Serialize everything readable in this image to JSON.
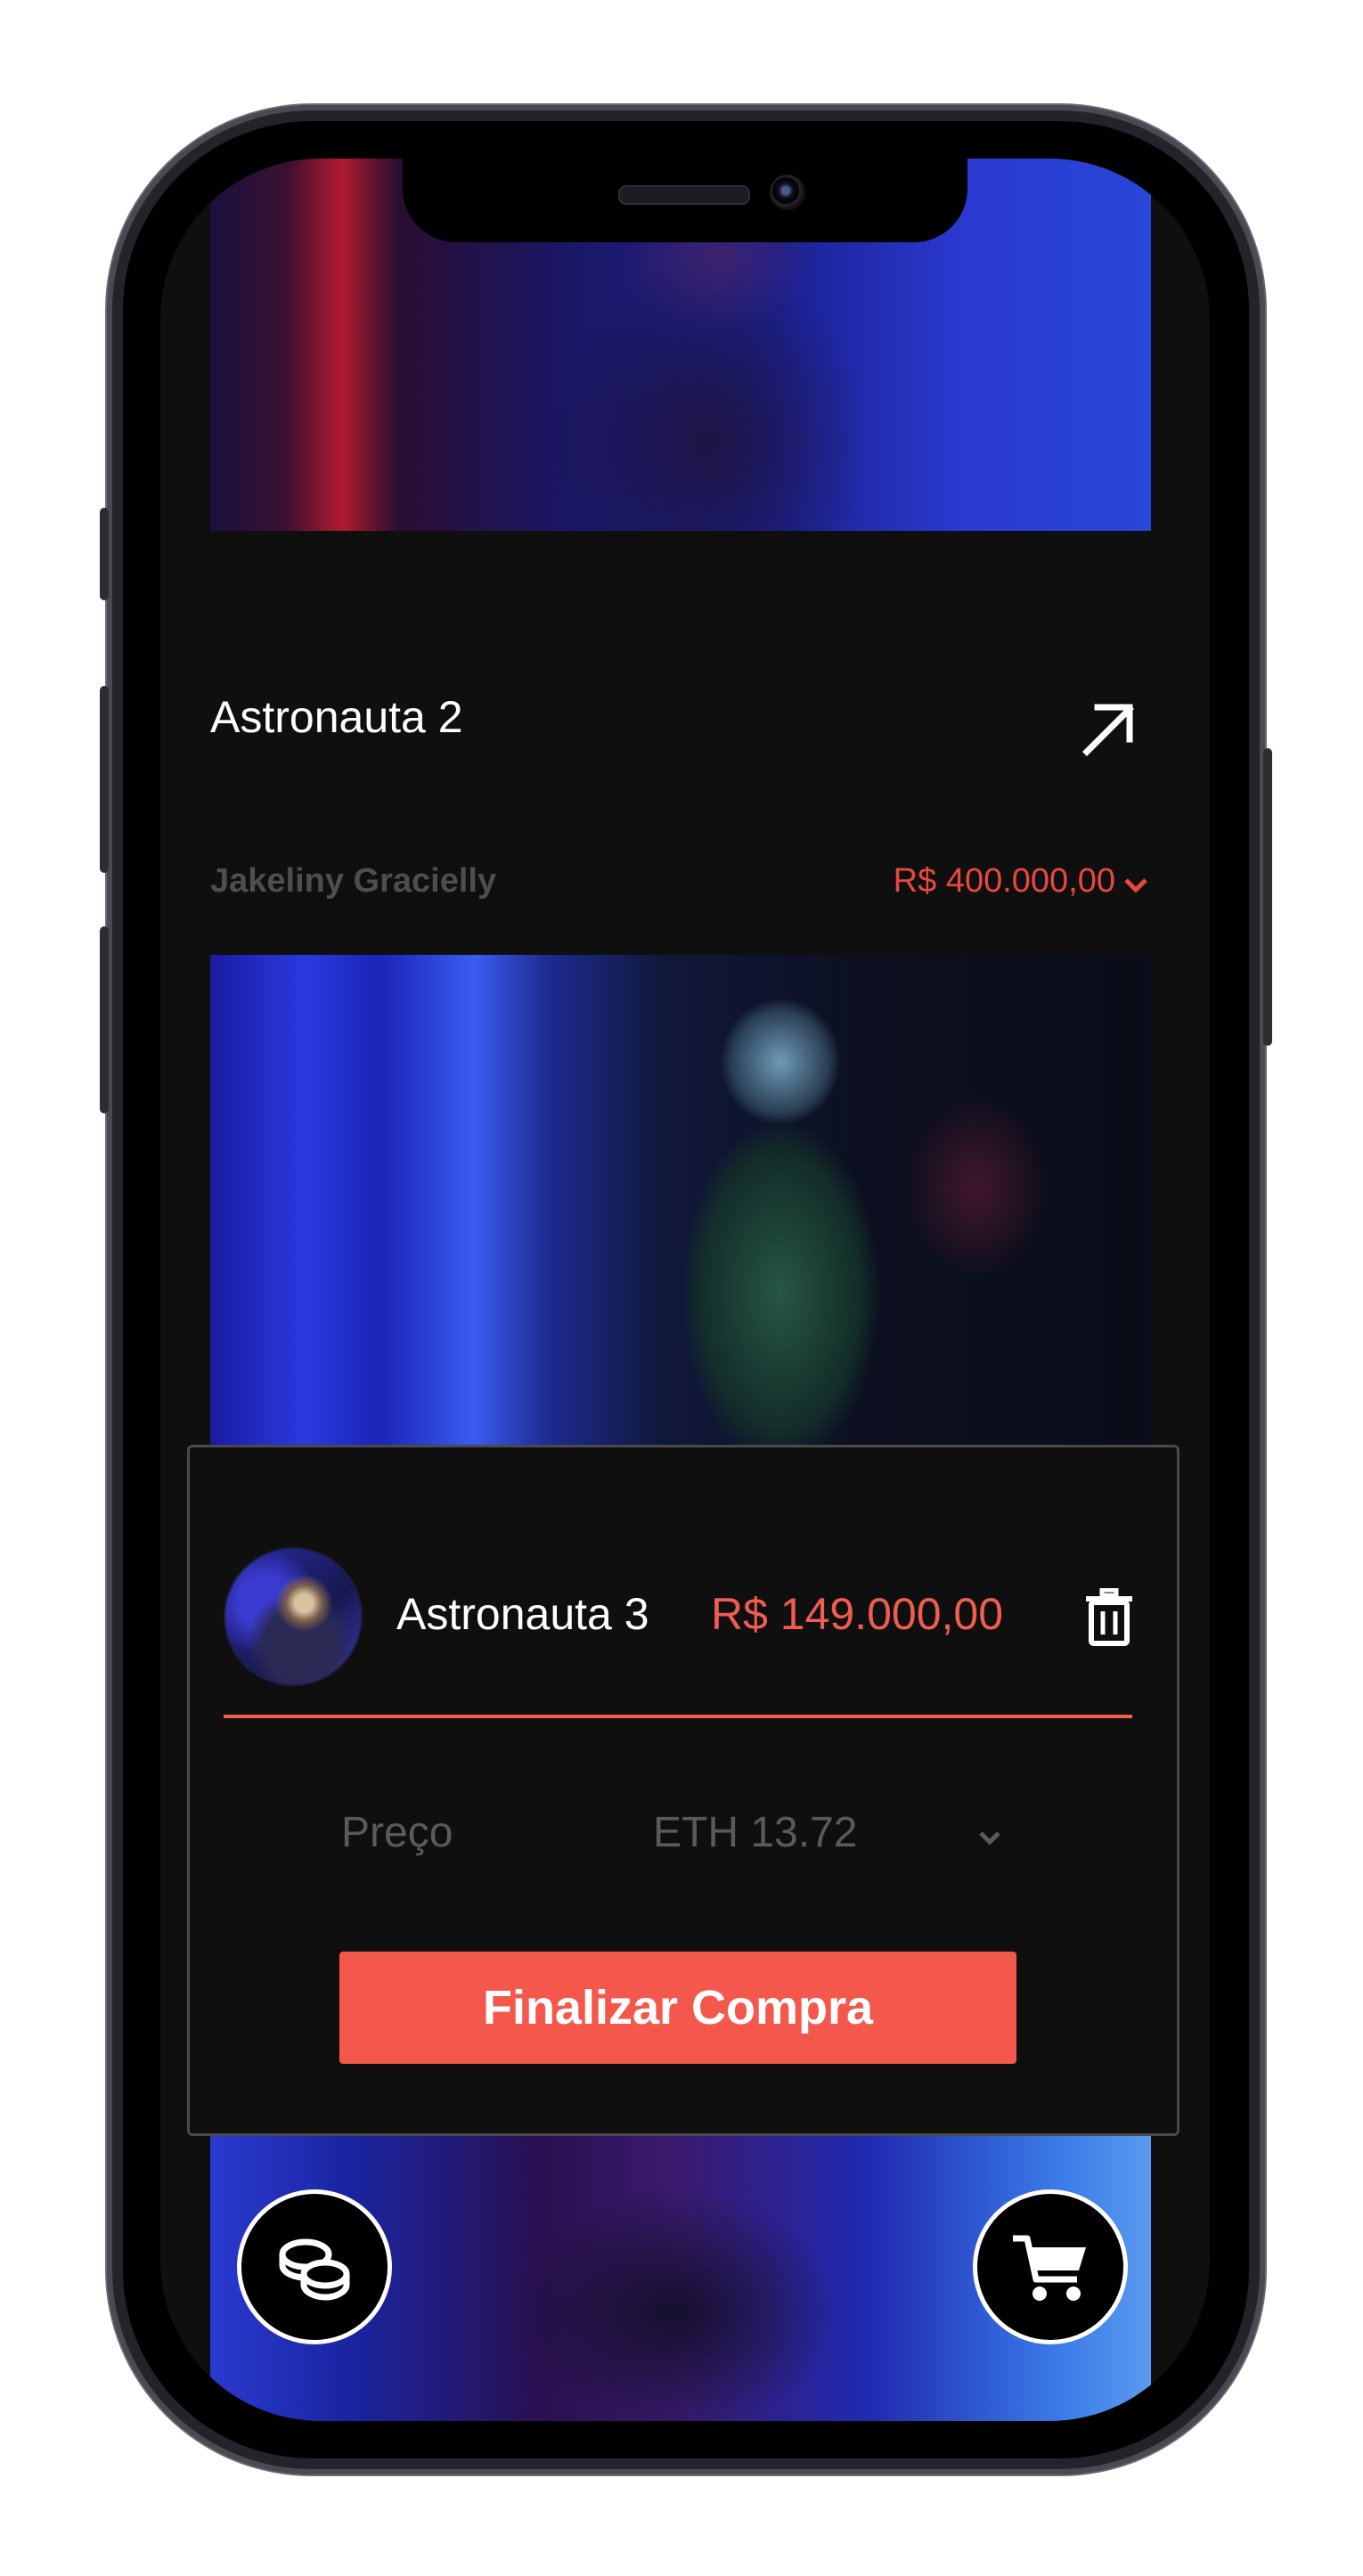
{
  "nft_card": {
    "title": "Astronauta 2",
    "author": "Jakeliny Gracielly",
    "price": "R$ 400.000,00",
    "icons": {
      "open": "arrow-up-right-icon",
      "expand": "chevron-down-icon"
    }
  },
  "cart_panel": {
    "item": {
      "name": "Astronauta 3",
      "price": "R$ 149.000,00",
      "remove_icon": "trash-icon"
    },
    "price_label": "Preço",
    "price_value": "ETH 13.72",
    "checkout_label": "Finalizar Compra"
  },
  "fabs": {
    "left_icon": "coins-icon",
    "right_icon": "cart-icon"
  },
  "colors": {
    "accent": "#f4584c",
    "background": "#0f0f0f",
    "muted_text": "#5a5a5a"
  }
}
